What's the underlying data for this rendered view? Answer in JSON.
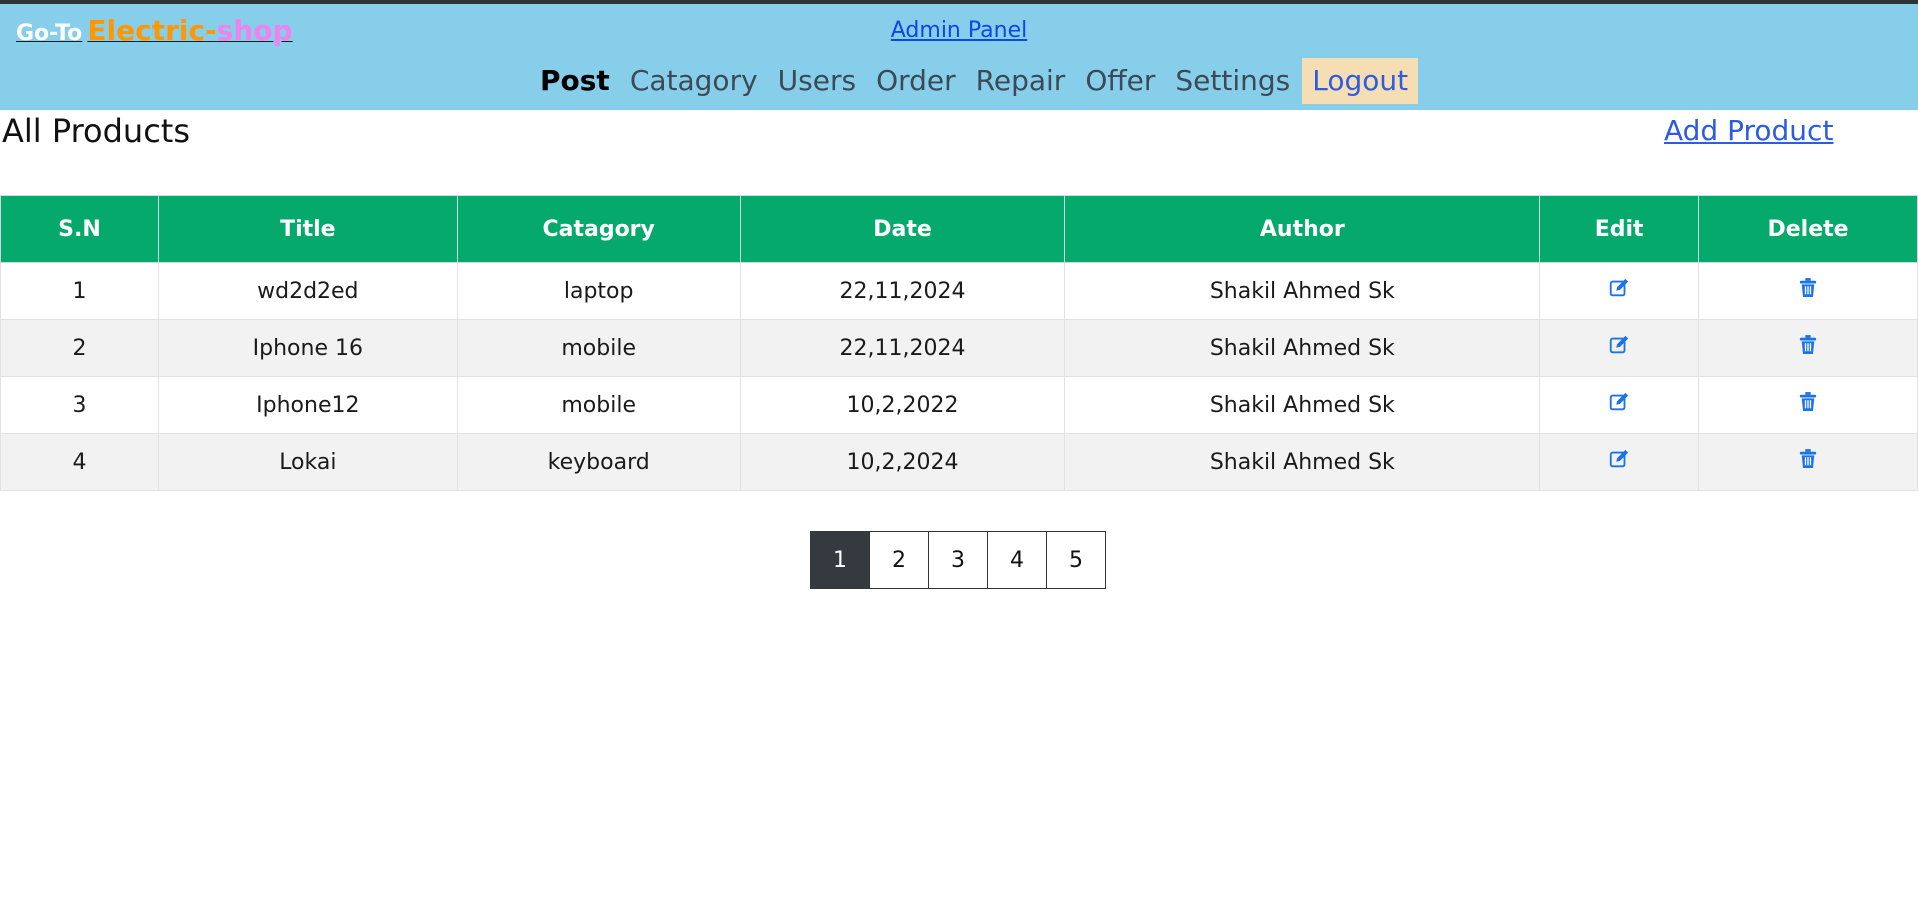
{
  "header": {
    "goto_label": "Go-To",
    "brand_electric": "Electric",
    "brand_dash": "-",
    "brand_shop": "shop",
    "admin_panel": "Admin Panel",
    "nav": [
      {
        "label": "Post",
        "active": true
      },
      {
        "label": "Catagory"
      },
      {
        "label": "Users"
      },
      {
        "label": "Order"
      },
      {
        "label": "Repair"
      },
      {
        "label": "Offer"
      },
      {
        "label": "Settings"
      },
      {
        "label": "Logout"
      }
    ]
  },
  "main": {
    "title": "All Products",
    "add_product": "Add Product"
  },
  "table": {
    "columns": [
      "S.N",
      "Title",
      "Catagory",
      "Date",
      "Author",
      "Edit",
      "Delete"
    ],
    "rows": [
      {
        "sn": "1",
        "title": "wd2d2ed",
        "category": "laptop",
        "date": "22,11,2024",
        "author": "Shakil Ahmed Sk"
      },
      {
        "sn": "2",
        "title": "Iphone 16",
        "category": "mobile",
        "date": "22,11,2024",
        "author": "Shakil Ahmed Sk"
      },
      {
        "sn": "3",
        "title": "Iphone12",
        "category": "mobile",
        "date": "10,2,2022",
        "author": "Shakil Ahmed Sk"
      },
      {
        "sn": "4",
        "title": "Lokai",
        "category": "keyboard",
        "date": "10,2,2024",
        "author": "Shakil Ahmed Sk"
      }
    ],
    "edit_icon": "edit-icon",
    "delete_icon": "trash-icon"
  },
  "pagination": {
    "pages": [
      "1",
      "2",
      "3",
      "4",
      "5"
    ],
    "current": "1"
  },
  "colors": {
    "header_bg": "#87ceeb",
    "table_header_bg": "#05a96b",
    "logout_bg": "#f5deb3",
    "active_page_bg": "#343a40",
    "icon_color": "#1a73e8"
  }
}
